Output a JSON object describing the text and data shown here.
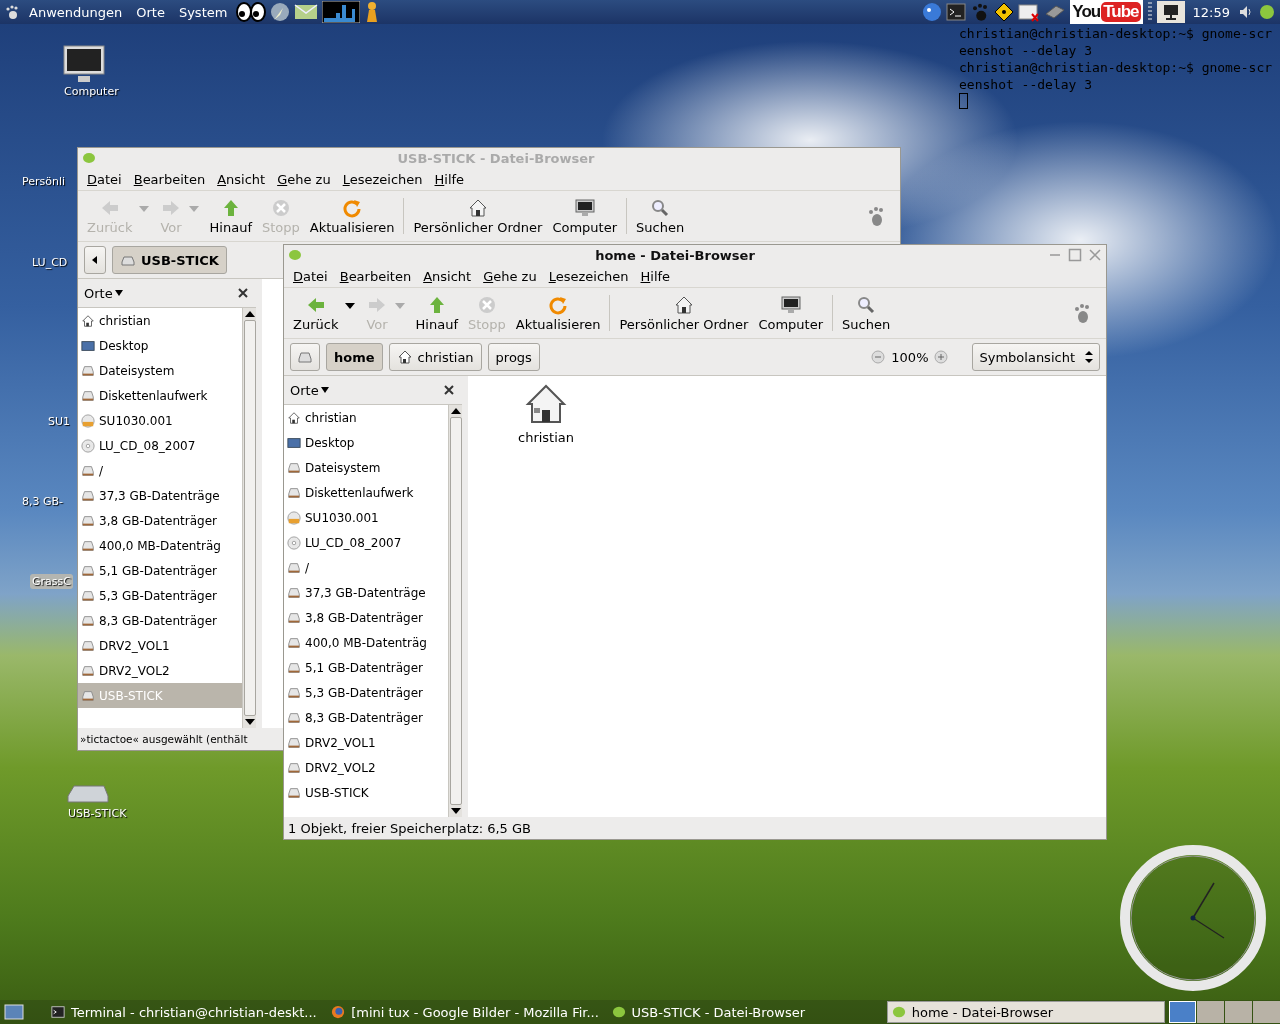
{
  "top_panel": {
    "menus": [
      "Anwendungen",
      "Orte",
      "System"
    ],
    "youtube": [
      "You",
      "Tube"
    ],
    "clock": "12:59"
  },
  "terminal": {
    "lines": [
      "christian@christian-desktop:~$ gnome-scr",
      "eenshot --delay 3",
      "christian@christian-desktop:~$ gnome-scr",
      "eenshot --delay 3"
    ]
  },
  "desktop_icons": [
    {
      "label": "Computer",
      "kind": "computer",
      "selected": false
    },
    {
      "label": "Persönli",
      "selected": false
    },
    {
      "label": "LU_CD",
      "selected": false
    },
    {
      "label": "SU1",
      "selected": false
    },
    {
      "label": "8,3 GB-",
      "selected": false
    },
    {
      "label": "GrassC",
      "selected": true
    },
    {
      "label": "USB-STICK",
      "kind": "usb",
      "selected": false
    }
  ],
  "windows": [
    {
      "title": "USB-STICK - Datei-Browser",
      "active": false,
      "menu": [
        "Datei",
        "Bearbeiten",
        "Ansicht",
        "Gehe zu",
        "Lesezeichen",
        "Hilfe"
      ],
      "toolbar": [
        [
          {
            "label": "Zurück",
            "kind": "back",
            "disabled": true,
            "has_menu": true
          },
          {
            "label": "Vor",
            "kind": "forward",
            "disabled": true,
            "has_menu": true
          },
          {
            "label": "Hinauf",
            "kind": "up",
            "disabled": false,
            "has_menu": false
          },
          {
            "label": "Stopp",
            "kind": "stop",
            "disabled": true,
            "has_menu": false
          },
          {
            "label": "Aktualisieren",
            "kind": "reload",
            "disabled": false,
            "has_menu": false
          }
        ],
        [
          {
            "label": "Persönlicher Ordner",
            "kind": "home",
            "disabled": false,
            "has_menu": false
          },
          {
            "label": "Computer",
            "kind": "computer",
            "disabled": false,
            "has_menu": false
          }
        ],
        [
          {
            "label": "Suchen",
            "kind": "search",
            "disabled": false,
            "has_menu": false
          }
        ]
      ],
      "path": [
        {
          "kind": "arrow",
          "selected": false
        },
        {
          "kind": "drive",
          "label": "USB-STICK",
          "selected": true
        }
      ],
      "sidebar": {
        "title": "Orte",
        "places": [
          {
            "label": "christian",
            "kind": "home",
            "selected": false
          },
          {
            "label": "Desktop",
            "kind": "desktop",
            "selected": false
          },
          {
            "label": "Dateisystem",
            "kind": "drive",
            "selected": false
          },
          {
            "label": "Diskettenlaufwerk",
            "kind": "drive",
            "selected": false
          },
          {
            "label": "SU1030.001",
            "kind": "photocd",
            "selected": false
          },
          {
            "label": "LU_CD_08_2007",
            "kind": "cdrom",
            "selected": false
          },
          {
            "label": "/",
            "kind": "drive",
            "selected": false
          },
          {
            "label": "37,3 GB-Datenträge",
            "kind": "drive",
            "selected": false
          },
          {
            "label": "3,8 GB-Datenträger",
            "kind": "drive",
            "selected": false
          },
          {
            "label": "400,0 MB-Datenträg",
            "kind": "drive",
            "selected": false
          },
          {
            "label": "5,1 GB-Datenträger",
            "kind": "drive",
            "selected": false
          },
          {
            "label": "5,3 GB-Datenträger",
            "kind": "drive",
            "selected": false
          },
          {
            "label": "8,3 GB-Datenträger",
            "kind": "drive",
            "selected": false
          },
          {
            "label": "DRV2_VOL1",
            "kind": "drive",
            "selected": false
          },
          {
            "label": "DRV2_VOL2",
            "kind": "drive",
            "selected": false
          },
          {
            "label": "USB-STICK",
            "kind": "drive",
            "selected": true
          }
        ]
      },
      "status": "»tictactoe« ausgewählt (enthält"
    },
    {
      "title": "home - Datei-Browser",
      "active": true,
      "menu": [
        "Datei",
        "Bearbeiten",
        "Ansicht",
        "Gehe zu",
        "Lesezeichen",
        "Hilfe"
      ],
      "toolbar": [
        [
          {
            "label": "Zurück",
            "kind": "back",
            "disabled": false,
            "has_menu": true
          },
          {
            "label": "Vor",
            "kind": "forward",
            "disabled": true,
            "has_menu": true
          },
          {
            "label": "Hinauf",
            "kind": "up",
            "disabled": false,
            "has_menu": false
          },
          {
            "label": "Stopp",
            "kind": "stop",
            "disabled": true,
            "has_menu": false
          },
          {
            "label": "Aktualisieren",
            "kind": "reload",
            "disabled": false,
            "has_menu": false
          }
        ],
        [
          {
            "label": "Persönlicher Ordner",
            "kind": "home",
            "disabled": false,
            "has_menu": false
          },
          {
            "label": "Computer",
            "kind": "computer",
            "disabled": false,
            "has_menu": false
          }
        ],
        [
          {
            "label": "Suchen",
            "kind": "search",
            "disabled": false,
            "has_menu": false
          }
        ]
      ],
      "path": [
        {
          "kind": "drive-toggle",
          "selected": false
        },
        {
          "kind": "plain",
          "label": "home",
          "selected": true
        },
        {
          "kind": "home",
          "label": "christian",
          "selected": false
        },
        {
          "kind": "plain",
          "label": "progs",
          "selected": false
        }
      ],
      "zoom": "100%",
      "view": "Symbolansicht",
      "sidebar": {
        "title": "Orte",
        "places": [
          {
            "label": "christian",
            "kind": "home",
            "selected": false
          },
          {
            "label": "Desktop",
            "kind": "desktop",
            "selected": false
          },
          {
            "label": "Dateisystem",
            "kind": "drive",
            "selected": false
          },
          {
            "label": "Diskettenlaufwerk",
            "kind": "drive",
            "selected": false
          },
          {
            "label": "SU1030.001",
            "kind": "photocd",
            "selected": false
          },
          {
            "label": "LU_CD_08_2007",
            "kind": "cdrom",
            "selected": false
          },
          {
            "label": "/",
            "kind": "drive",
            "selected": false
          },
          {
            "label": "37,3 GB-Datenträge",
            "kind": "drive",
            "selected": false
          },
          {
            "label": "3,8 GB-Datenträger",
            "kind": "drive",
            "selected": false
          },
          {
            "label": "400,0 MB-Datenträg",
            "kind": "drive",
            "selected": false
          },
          {
            "label": "5,1 GB-Datenträger",
            "kind": "drive",
            "selected": false
          },
          {
            "label": "5,3 GB-Datenträger",
            "kind": "drive",
            "selected": false
          },
          {
            "label": "8,3 GB-Datenträger",
            "kind": "drive",
            "selected": false
          },
          {
            "label": "DRV2_VOL1",
            "kind": "drive",
            "selected": false
          },
          {
            "label": "DRV2_VOL2",
            "kind": "drive",
            "selected": false
          },
          {
            "label": "USB-STICK",
            "kind": "drive",
            "selected": false
          }
        ]
      },
      "content": [
        {
          "label": "christian",
          "kind": "home"
        }
      ],
      "status": "1 Objekt, freier Speicherplatz: 6,5 GB"
    }
  ],
  "taskbar": {
    "tasks": [
      {
        "label": "Terminal - christian@christian-deskt...",
        "kind": "terminal",
        "selected": false
      },
      {
        "label": "[mini tux - Google Bilder - Mozilla Fir...",
        "kind": "browser",
        "selected": false
      },
      {
        "label": "USB-STICK - Datei-Browser",
        "kind": "files",
        "selected": false
      },
      {
        "label": "home - Datei-Browser",
        "kind": "files",
        "selected": true
      }
    ],
    "workspaces": [
      {
        "selected": true
      },
      {
        "selected": false
      },
      {
        "selected": false
      },
      {
        "selected": false
      }
    ]
  }
}
